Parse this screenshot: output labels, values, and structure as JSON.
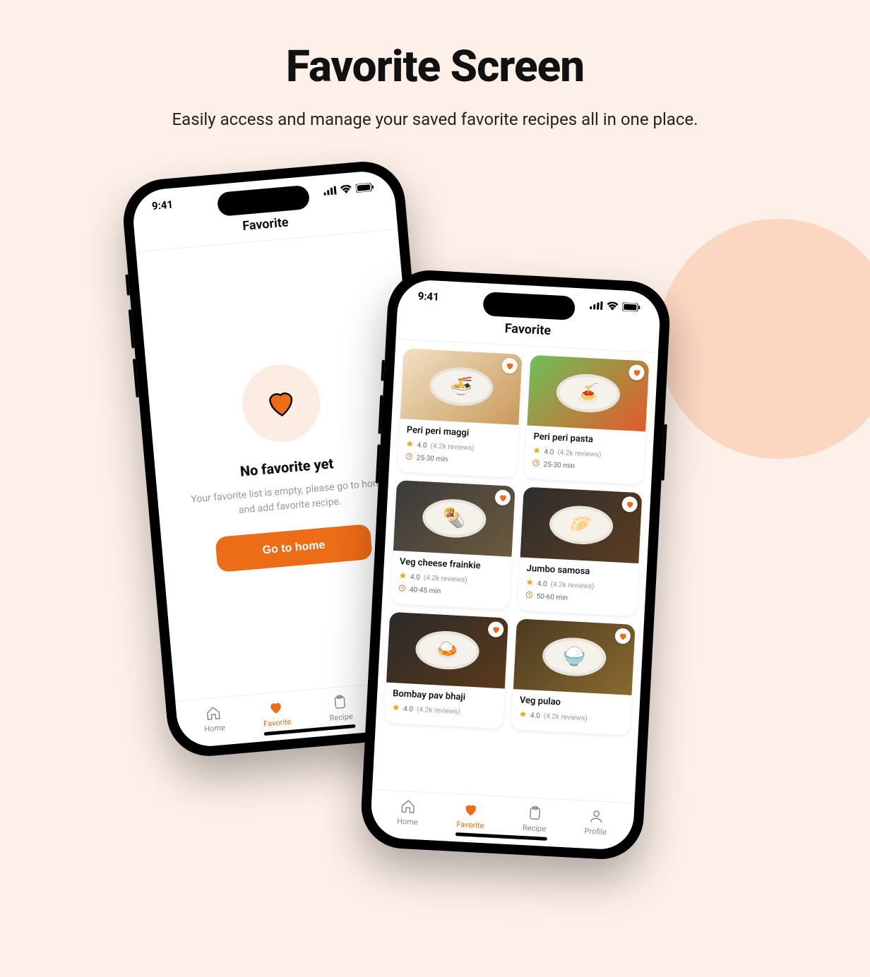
{
  "hero": {
    "title": "Favorite Screen",
    "subtitle": "Easily access and manage your saved favorite recipes all in one place."
  },
  "status": {
    "time": "9:41"
  },
  "phone1": {
    "header": "Favorite",
    "empty_title": "No favorite yet",
    "empty_subtitle": "Your favorite list is empty, please go to home and add favorite recipe.",
    "cta_label": "Go to home"
  },
  "phone2": {
    "header": "Favorite"
  },
  "recipes": [
    {
      "name": "Peri peri maggi",
      "rating": "4.0",
      "reviews": "(4.2k reviews)",
      "time": "25-30 min",
      "emoji": "🍜",
      "bg": "linear-gradient(135deg,#f1e0c4,#c99a5a)"
    },
    {
      "name": "Peri peri pasta",
      "rating": "4.0",
      "reviews": "(4.2k reviews)",
      "time": "25-30 min",
      "emoji": "🍝",
      "bg": "linear-gradient(135deg,#6fbf5a,#e35a2a)"
    },
    {
      "name": "Veg cheese frainkie",
      "rating": "4.0",
      "reviews": "(4.2k reviews)",
      "time": "40-45 min",
      "emoji": "🌯",
      "bg": "linear-gradient(135deg,#3a3a3a,#6b5a3f)"
    },
    {
      "name": "Jumbo samosa",
      "rating": "4.0",
      "reviews": "(4.2k reviews)",
      "time": "50-60 min",
      "emoji": "🥟",
      "bg": "linear-gradient(135deg,#2d2d2d,#5c3d20)"
    },
    {
      "name": "Bombay pav bhaji",
      "rating": "4.0",
      "reviews": "(4.2k reviews)",
      "time": "",
      "emoji": "🍛",
      "bg": "linear-gradient(135deg,#2a2a2a,#5a3a1a)"
    },
    {
      "name": "Veg pulao",
      "rating": "4.0",
      "reviews": "(4.2k reviews)",
      "time": "",
      "emoji": "🍚",
      "bg": "linear-gradient(135deg,#4a3a20,#8a6a30)"
    }
  ],
  "nav": {
    "home": "Home",
    "favorite": "Favorite",
    "recipe": "Recipe",
    "profile": "Profile"
  }
}
